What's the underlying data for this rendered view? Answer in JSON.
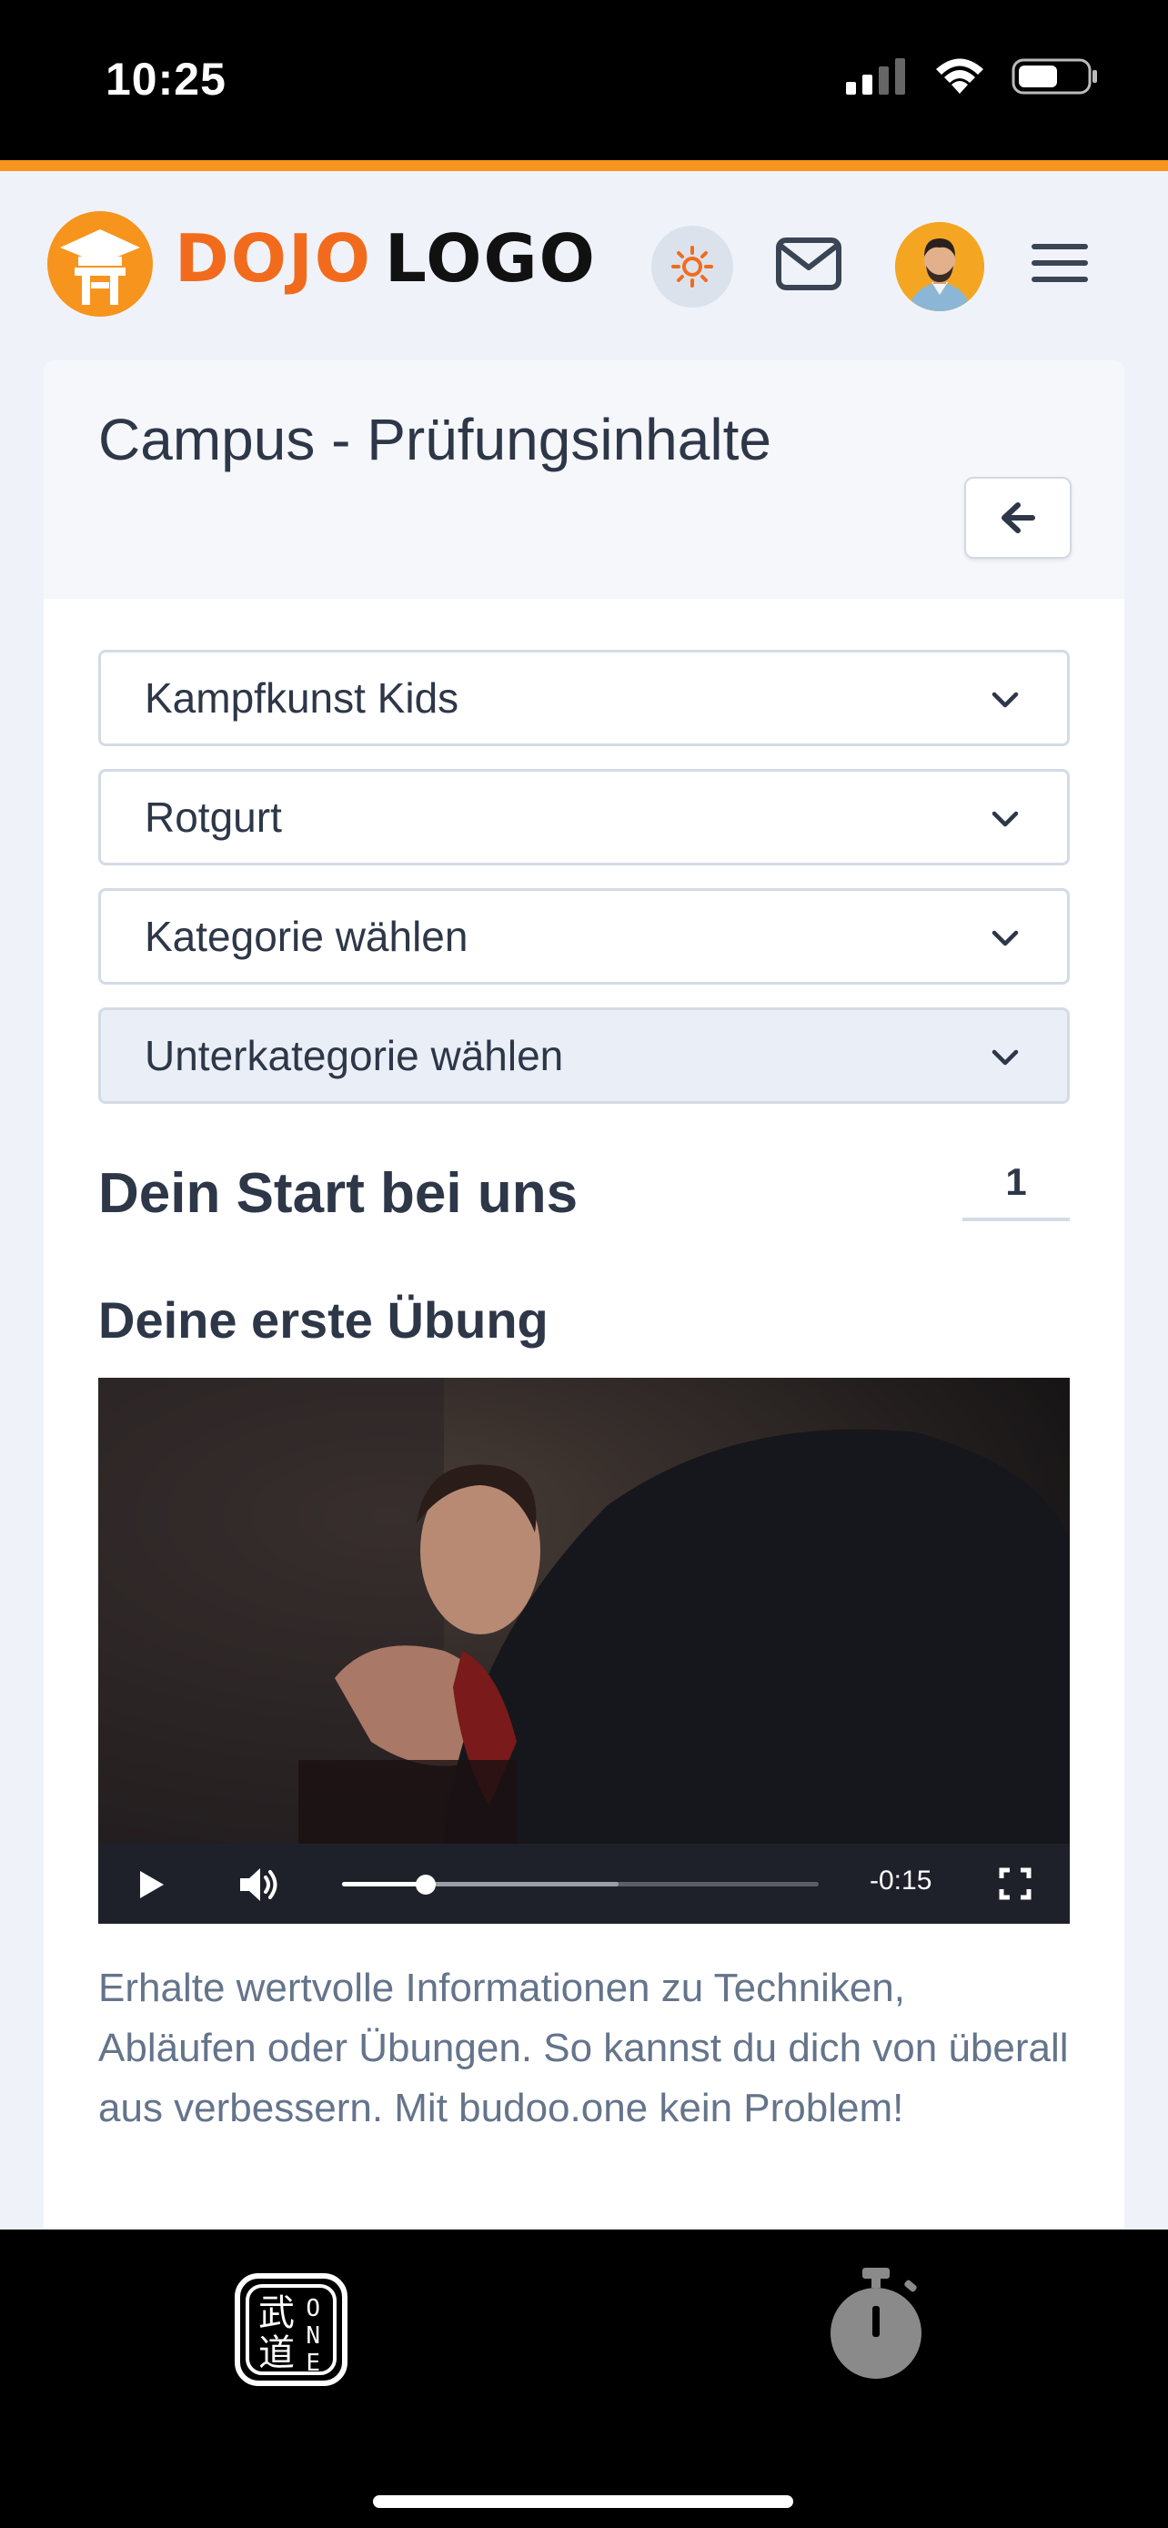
{
  "status_bar": {
    "time": "10:25",
    "icons": [
      "signal-icon",
      "wifi-icon",
      "battery-icon"
    ]
  },
  "brand": {
    "word1": "DOJO",
    "word2": "LOGO",
    "accent_color": "#f7941d",
    "logo_color": "#f26b1d"
  },
  "header": {
    "icons": [
      "sun-icon",
      "mail-icon",
      "avatar",
      "hamburger-menu-icon"
    ]
  },
  "page": {
    "title": "Campus - Prüfungsinhalte",
    "back_icon": "arrow-left-icon"
  },
  "filters": [
    {
      "value": "Kampfkunst Kids"
    },
    {
      "value": "Rotgurt"
    },
    {
      "value": "Kategorie wählen"
    },
    {
      "value": "Unterkategorie wählen"
    }
  ],
  "section": {
    "title": "Dein Start bei uns",
    "counter": "1"
  },
  "exercise": {
    "title": "Deine erste Übung",
    "video": {
      "time_remaining": "-0:15",
      "progress": 0.176,
      "buffered": 0.58
    },
    "description": "Erhalte wertvolle Informationen zu Techniken, Abläufen oder Übungen. So kannst du dich von überall aus verbessern. Mit budoo.one kein Problem!"
  },
  "tabbar": {
    "tabs": [
      {
        "icon": "budoo-one-icon",
        "text": "O N E"
      },
      {
        "icon": "stopwatch-icon"
      }
    ]
  }
}
